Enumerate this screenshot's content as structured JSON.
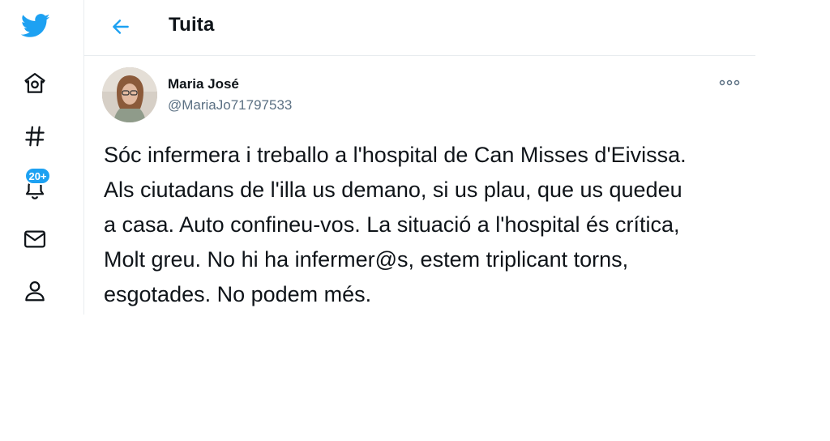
{
  "icons": {
    "twitter": "twitter-bird",
    "home": "home",
    "explore": "hashtag",
    "notifications": "bell",
    "messages": "envelope",
    "profile": "person",
    "back": "arrow-left",
    "more": "more-horizontal"
  },
  "colors": {
    "accent": "#1da1f2",
    "text": "#0f1419",
    "muted": "#5b7083"
  },
  "sidebar": {
    "notifications_badge": "20+"
  },
  "header": {
    "title": "Tuita"
  },
  "tweet": {
    "author_name": "Maria José",
    "author_handle": "@MariaJo71797533",
    "text_lines": [
      "Sóc infermera i treballo a l'hospital de Can Misses d'Eivissa.",
      "Als ciutadans de l'illa us demano, si us plau, que us quedeu",
      "a casa. Auto confineu-vos. La situació a l'hospital és crítica,",
      "Molt greu. No hi ha infermer@s, estem triplicant torns,",
      "esgotades. No podem més."
    ]
  }
}
